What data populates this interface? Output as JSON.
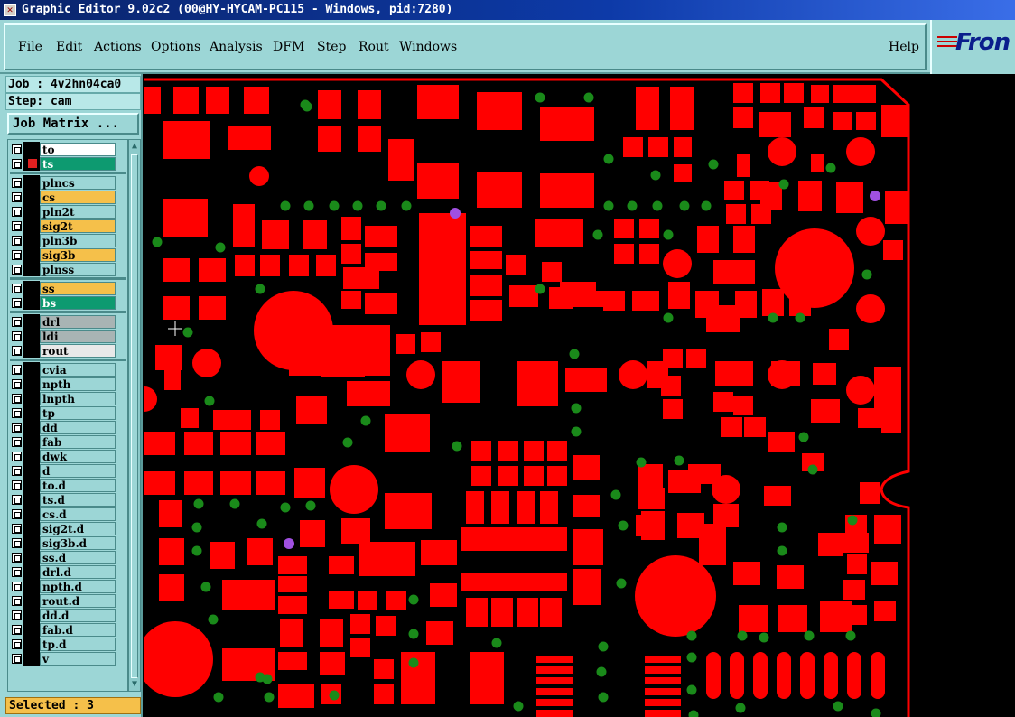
{
  "window": {
    "title": "Graphic Editor 9.02c2 (00@HY-HYCAM-PC115 - Windows, pid:7280)"
  },
  "menu": {
    "items": [
      "File",
      "Edit",
      "Actions",
      "Options",
      "Analysis",
      "DFM",
      "Step",
      "Rout",
      "Windows"
    ],
    "help": "Help"
  },
  "logo": {
    "text": "Fron"
  },
  "job": {
    "label": "Job : 4v2hn04ca0",
    "step": "Step: cam",
    "matrix_button": "Job Matrix ..."
  },
  "layers": [
    {
      "name": "to",
      "color": "#ffffff",
      "group": 0
    },
    {
      "name": "ts",
      "color": "#0d9a70",
      "group": 0,
      "chip": "#e02020"
    },
    {
      "name": "plncs",
      "color": "#9cd6d6",
      "group": 1
    },
    {
      "name": "cs",
      "color": "#f5c04a",
      "group": 1
    },
    {
      "name": "pln2t",
      "color": "#9cd6d6",
      "group": 1
    },
    {
      "name": "sig2t",
      "color": "#f5c04a",
      "group": 1
    },
    {
      "name": "pln3b",
      "color": "#9cd6d6",
      "group": 1
    },
    {
      "name": "sig3b",
      "color": "#f5c04a",
      "group": 1
    },
    {
      "name": "plnss",
      "color": "#9cd6d6",
      "group": 1
    },
    {
      "name": "ss",
      "color": "#f5c04a",
      "group": 2
    },
    {
      "name": "bs",
      "color": "#0d9a70",
      "group": 2
    },
    {
      "name": "drl",
      "color": "#a8b4b4",
      "group": 3
    },
    {
      "name": "ldi",
      "color": "#a8b4b4",
      "group": 3
    },
    {
      "name": "rout",
      "color": "#e8e8e8",
      "group": 3
    },
    {
      "name": "cvia",
      "color": "#9cd6d6",
      "group": 4
    },
    {
      "name": "npth",
      "color": "#9cd6d6",
      "group": 4
    },
    {
      "name": "lnpth",
      "color": "#9cd6d6",
      "group": 4
    },
    {
      "name": "tp",
      "color": "#9cd6d6",
      "group": 4
    },
    {
      "name": "dd",
      "color": "#9cd6d6",
      "group": 4
    },
    {
      "name": "fab",
      "color": "#9cd6d6",
      "group": 4
    },
    {
      "name": "dwk",
      "color": "#9cd6d6",
      "group": 4
    },
    {
      "name": "d",
      "color": "#9cd6d6",
      "group": 4
    },
    {
      "name": "to.d",
      "color": "#9cd6d6",
      "group": 4
    },
    {
      "name": "ts.d",
      "color": "#9cd6d6",
      "group": 4
    },
    {
      "name": "cs.d",
      "color": "#9cd6d6",
      "group": 4
    },
    {
      "name": "sig2t.d",
      "color": "#9cd6d6",
      "group": 4
    },
    {
      "name": "sig3b.d",
      "color": "#9cd6d6",
      "group": 4
    },
    {
      "name": "ss.d",
      "color": "#9cd6d6",
      "group": 4
    },
    {
      "name": "drl.d",
      "color": "#9cd6d6",
      "group": 4
    },
    {
      "name": "npth.d",
      "color": "#9cd6d6",
      "group": 4
    },
    {
      "name": "rout.d",
      "color": "#9cd6d6",
      "group": 4
    },
    {
      "name": "dd.d",
      "color": "#9cd6d6",
      "group": 4
    },
    {
      "name": "fab.d",
      "color": "#9cd6d6",
      "group": 4
    },
    {
      "name": "tp.d",
      "color": "#9cd6d6",
      "group": 4
    },
    {
      "name": "v",
      "color": "#9cd6d6",
      "group": 4
    }
  ],
  "status": {
    "selected": "Selected : 3"
  },
  "colors": {
    "pad": "#ff0000",
    "via": "#1a8a1a",
    "selected_via": "#a050e0",
    "panel": "#9cd6d6"
  }
}
